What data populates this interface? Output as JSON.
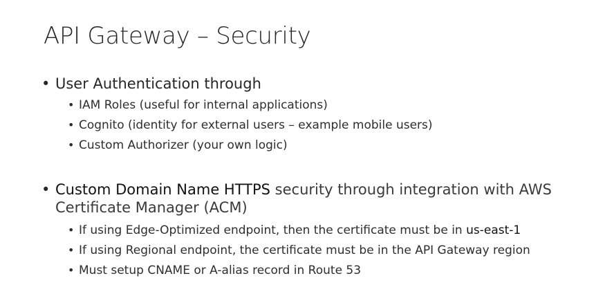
{
  "title": "API Gateway – Security",
  "section1": {
    "bullet": "•",
    "heading": "User Authentication through",
    "items": [
      "IAM Roles (useful for internal applications)",
      "Cognito (identity for external users – example mobile users)",
      "Custom Authorizer (your own logic)"
    ]
  },
  "section2": {
    "bullet": "•",
    "heading_strong": "Custom Domain Name HTTPS",
    "heading_rest": " security through integration with AWS",
    "heading_line2": "Certificate Manager (ACM)",
    "items": [
      {
        "text": "If using Edge-Optimized endpoint, then the certificate must be in ",
        "emph": "us-east-1"
      },
      {
        "text": "If using Regional endpoint, the certificate must be in the API Gateway region",
        "emph": ""
      },
      {
        "text": "Must setup CNAME or A-alias record in Route 53",
        "emph": ""
      }
    ]
  }
}
